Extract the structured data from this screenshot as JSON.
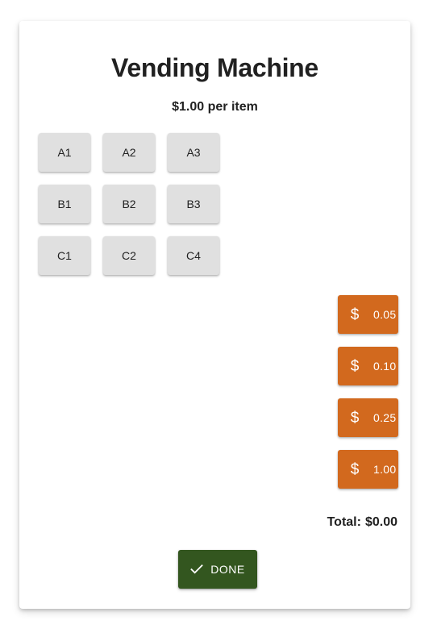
{
  "header": {
    "title": "Vending Machine",
    "price_text": "$1.00 per item"
  },
  "slots": [
    {
      "label": "A1"
    },
    {
      "label": "A2"
    },
    {
      "label": "A3"
    },
    {
      "label": "B1"
    },
    {
      "label": "B2"
    },
    {
      "label": "B3"
    },
    {
      "label": "C1"
    },
    {
      "label": "C2"
    },
    {
      "label": "C4"
    }
  ],
  "coins": [
    {
      "icon": "dollar-icon",
      "symbol": "$",
      "value": "0.05"
    },
    {
      "icon": "dollar-icon",
      "symbol": "$",
      "value": "0.10"
    },
    {
      "icon": "dollar-icon",
      "symbol": "$",
      "value": "0.25"
    },
    {
      "icon": "dollar-icon",
      "symbol": "$",
      "value": "1.00"
    }
  ],
  "total": {
    "label": "Total:",
    "amount": "$0.00"
  },
  "done_button": {
    "icon": "checkmark-icon",
    "label": "DONE"
  },
  "colors": {
    "slot_bg": "#e0e0e0",
    "coin_bg": "#d2691e",
    "done_bg": "#33561f"
  }
}
